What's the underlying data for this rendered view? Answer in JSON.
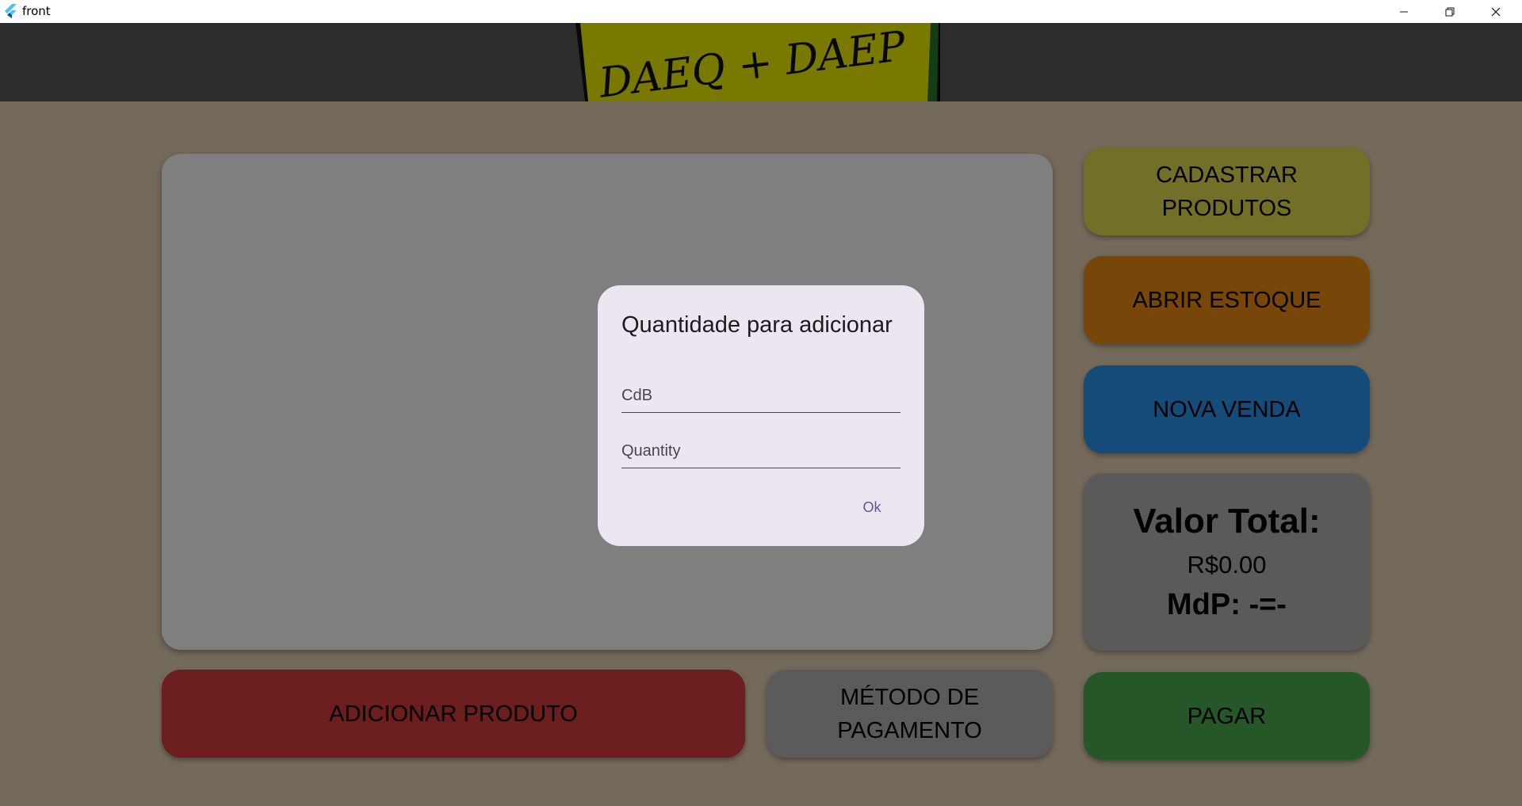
{
  "window": {
    "title": "front",
    "minimize_icon": "minimize-icon",
    "maximize_icon": "restore-icon",
    "close_icon": "close-icon"
  },
  "header": {
    "logo_text": "DAEQ + DAEP",
    "logo_background": "#f2f200"
  },
  "buttons": {
    "cadastrar": "CADASTRAR\nPRODUTOS",
    "estoque": "ABRIR ESTOQUE",
    "nova_venda": "NOVA VENDA",
    "adicionar": "ADICIONAR PRODUTO",
    "metodo": "MÉTODO DE\nPAGAMENTO",
    "pagar": "PAGAR"
  },
  "total": {
    "label": "Valor Total:",
    "value": "R$0.00",
    "mdp": "MdP: -=-"
  },
  "dialog": {
    "title": "Quantidade para adicionar",
    "cdb_placeholder": "CdB",
    "cdb_value": "",
    "quantity_placeholder": "Quantity",
    "quantity_value": "",
    "ok_label": "Ok"
  },
  "colors": {
    "cadastrar": "#e2de50",
    "estoque": "#ef8c10",
    "nova_venda": "#2b97f3",
    "adicionar": "#d83a3a",
    "metodo": "#b7b6bc",
    "pagar": "#4caf50",
    "total_panel": "#b4b4b4",
    "background": "#e8d4b8",
    "dialog": "#ece6f0",
    "accent": "#65558f"
  }
}
